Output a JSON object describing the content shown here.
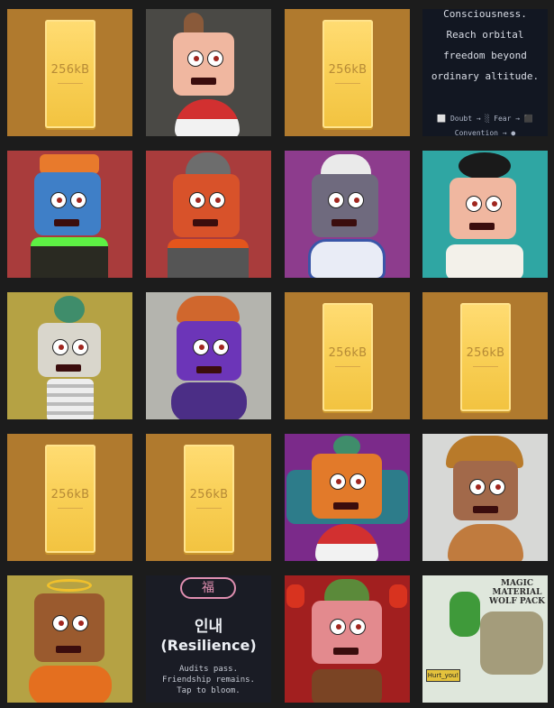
{
  "gallery": {
    "placeholder_label": "256kB",
    "text_tile": {
      "lines": [
        "Consciousness.",
        "Reach orbital",
        "freedom beyond",
        "ordinary altitude."
      ],
      "footer_line1": "⬜ Doubt → ░ Fear → ⬛",
      "footer_line2": "Convention → ●"
    },
    "resilience_tile": {
      "charm_char": "福",
      "korean_title": "인내",
      "english_title": "(Resilience)",
      "line1": "Audits pass.",
      "line2": "Friendship remains.",
      "line3": "Tap to bloom."
    },
    "sketch_tile": {
      "title": "MAGIC MATERIAL WOLF PACK",
      "sign": "Hurt_you!"
    }
  },
  "colors": {
    "page_bg": "#1c1c1c",
    "gold_tile_bg": "#b07a2e",
    "bar_fill": "#f9cf55",
    "charm_pink": "#e08fb1"
  }
}
